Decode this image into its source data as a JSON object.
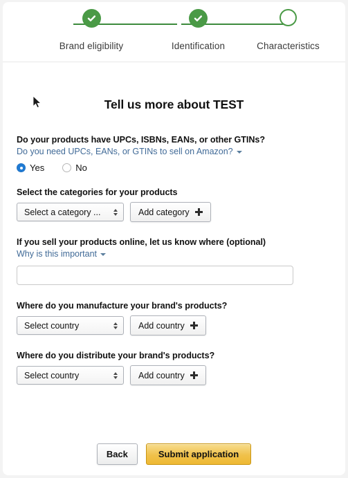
{
  "progress": {
    "steps": [
      {
        "label": "Brand eligibility",
        "state": "completed",
        "icon": "check-circle-icon"
      },
      {
        "label": "Identification",
        "state": "completed",
        "icon": "check-circle-icon"
      },
      {
        "label": "Characteristics",
        "state": "current",
        "icon": "empty-circle-icon"
      }
    ],
    "accent_color": "#4a9a46"
  },
  "main": {
    "title": "Tell us more about TEST",
    "gtin": {
      "question": "Do your products have UPCs, ISBNs, EANs, or other GTINs?",
      "help_link": "Do you need UPCs, EANs, or GTINs to sell on Amazon?",
      "options": [
        {
          "label": "Yes",
          "selected": true
        },
        {
          "label": "No",
          "selected": false
        }
      ]
    },
    "categories": {
      "label": "Select the categories for your products",
      "select_value": "Select a category ...",
      "add_button": "Add category"
    },
    "online": {
      "label": "If you sell your products online, let us know where (optional)",
      "help_link": "Why is this important",
      "input_value": "",
      "input_placeholder": ""
    },
    "manufacture": {
      "label": "Where do you manufacture your brand's products?",
      "select_value": "Select country",
      "add_button": "Add country"
    },
    "distribute": {
      "label": "Where do you distribute your brand's products?",
      "select_value": "Select country",
      "add_button": "Add country"
    }
  },
  "footer": {
    "back_label": "Back",
    "submit_label": "Submit application",
    "submit_color": "#f0c14b"
  }
}
